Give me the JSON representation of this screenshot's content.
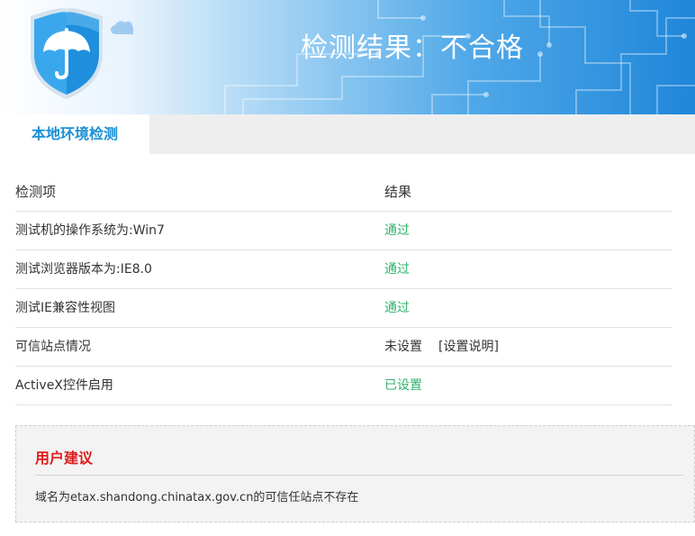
{
  "header": {
    "title": "检测结果：不合格",
    "logo_icon": "shield-umbrella-icon"
  },
  "tabs": [
    {
      "label": "本地环境检测",
      "active": true
    }
  ],
  "table": {
    "columns": [
      "检测项",
      "结果"
    ],
    "rows": [
      {
        "item": "测试机的操作系统为:Win7",
        "result": "通过",
        "status": "pass"
      },
      {
        "item": "测试浏览器版本为:IE8.0",
        "result": "通过",
        "status": "pass"
      },
      {
        "item": "测试IE兼容性视图",
        "result": "通过",
        "status": "pass"
      },
      {
        "item": "可信站点情况",
        "result": "未设置",
        "status": "neutral",
        "link": "[设置说明]"
      },
      {
        "item": "ActiveX控件启用",
        "result": "已设置",
        "status": "pass"
      }
    ]
  },
  "advice": {
    "title": "用户建议",
    "text": "域名为etax.shandong.chinatax.gov.cn的可信任站点不存在"
  },
  "colors": {
    "accent": "#1a8fd4",
    "pass": "#2fb36b",
    "warning": "#e01b1b"
  }
}
